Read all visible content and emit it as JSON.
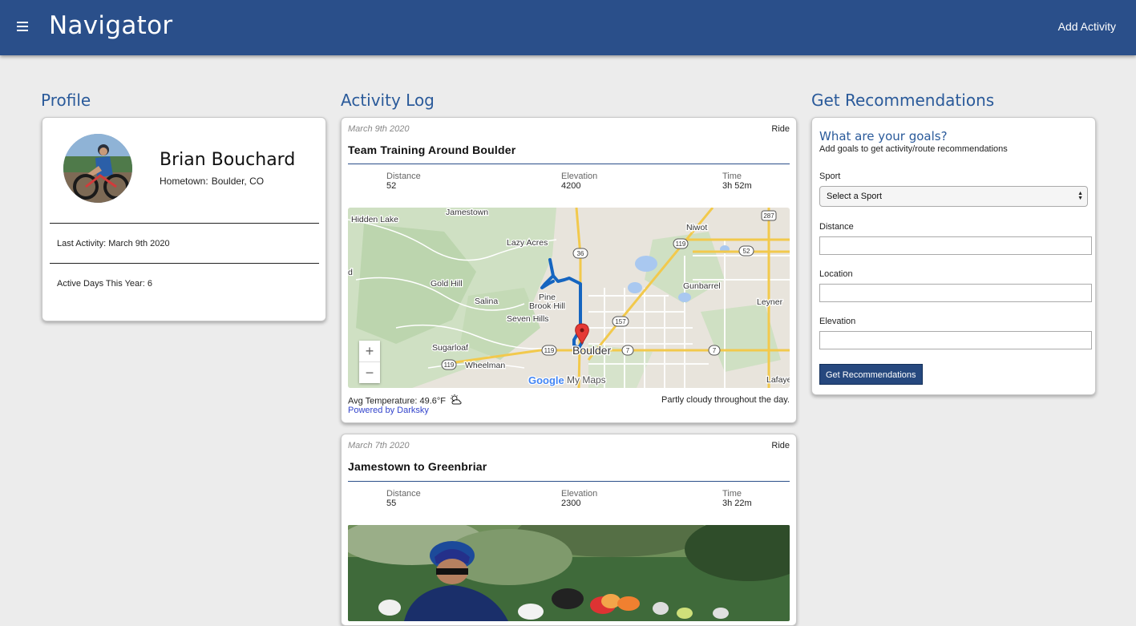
{
  "header": {
    "brand": "Navigator",
    "add_activity": "Add Activity",
    "bg_color": "#2a4f8a"
  },
  "profile": {
    "section_title": "Profile",
    "name": "Brian Bouchard",
    "hometown_label": "Hometown:",
    "hometown": "Boulder, CO",
    "last_activity": "Last Activity: March 9th 2020",
    "active_days": "Active Days This Year: 6"
  },
  "activity_log": {
    "section_title": "Activity Log",
    "activities": [
      {
        "date": "March 9th 2020",
        "type": "Ride",
        "title": "Team Training Around Boulder",
        "distance_label": "Distance",
        "distance": "52",
        "elevation_label": "Elevation",
        "elevation": "4200",
        "time_label": "Time",
        "time": "3h 52m",
        "avg_temperature": "Avg Temperature: 49.6°F",
        "weather_icon": "partly-cloudy-icon",
        "powered_by": "Powered by Darksky",
        "summary": "Partly cloudy throughout the day.",
        "map": {
          "places": [
            "Hidden Lake",
            "Jamestown",
            "Lazy Acres",
            "Niwot",
            "Gold Hill",
            "Gunbarrel",
            "Pine",
            "Brook Hill",
            "Salina",
            "Leyner",
            "Seven Hills",
            "Sugarloaf",
            "Boulder",
            "Wheelman",
            "Lafaye",
            "d"
          ],
          "highways": [
            "287",
            "119",
            "36",
            "52",
            "157",
            "7",
            "119",
            "7",
            "119"
          ],
          "attribution_google": "Google",
          "attribution_mymaps": "My Maps",
          "zoom_in": "+",
          "zoom_out": "−"
        }
      },
      {
        "date": "March 7th 2020",
        "type": "Ride",
        "title": "Jamestown to Greenbriar",
        "distance_label": "Distance",
        "distance": "55",
        "elevation_label": "Elevation",
        "elevation": "2300",
        "time_label": "Time",
        "time": "3h 22m"
      }
    ]
  },
  "recommendations": {
    "section_title": "Get Recommendations",
    "goals_title": "What are your goals?",
    "goals_subtitle": "Add goals to get activity/route recommendations",
    "sport_label": "Sport",
    "sport_selected": "Select a Sport",
    "distance_label": "Distance",
    "location_label": "Location",
    "elevation_label": "Elevation",
    "button": "Get Recommendations"
  }
}
